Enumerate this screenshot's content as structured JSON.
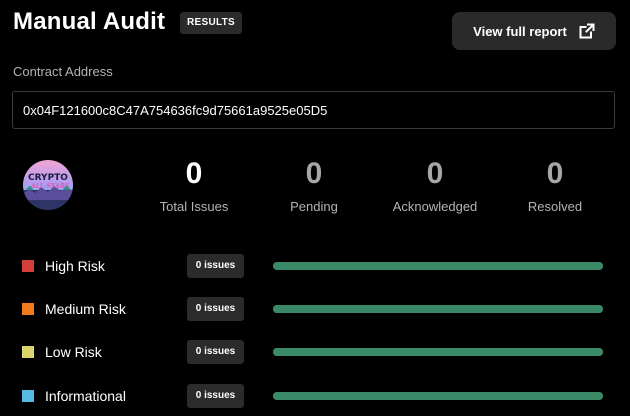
{
  "header": {
    "title": "Manual Audit",
    "badge": "RESULTS",
    "report_button": "View full report",
    "report_icon": "external-link-icon"
  },
  "contract": {
    "label": "Contract Address",
    "address": "0x04F121600c8C47A754636fc9d75661a9525e05D5"
  },
  "avatar": {
    "logo_text": "CRYPTO",
    "logo_subtext": "ALL-STARS"
  },
  "stats": [
    {
      "value": "0",
      "label": "Total Issues"
    },
    {
      "value": "0",
      "label": "Pending"
    },
    {
      "value": "0",
      "label": "Acknowledged"
    },
    {
      "value": "0",
      "label": "Resolved"
    }
  ],
  "risks": [
    {
      "name": "High Risk",
      "issues": "0 issues",
      "color": "#d43f3a",
      "bar_fill": 1.0
    },
    {
      "name": "Medium Risk",
      "issues": "0 issues",
      "color": "#f07a1e",
      "bar_fill": 1.0
    },
    {
      "name": "Low Risk",
      "issues": "0 issues",
      "color": "#d8d66a",
      "bar_fill": 1.0
    },
    {
      "name": "Informational",
      "issues": "0 issues",
      "color": "#57b9e3",
      "bar_fill": 1.0
    }
  ],
  "colors": {
    "bar": "#3b8a67",
    "badge_bg": "#2b2b2b",
    "background": "#000000"
  }
}
